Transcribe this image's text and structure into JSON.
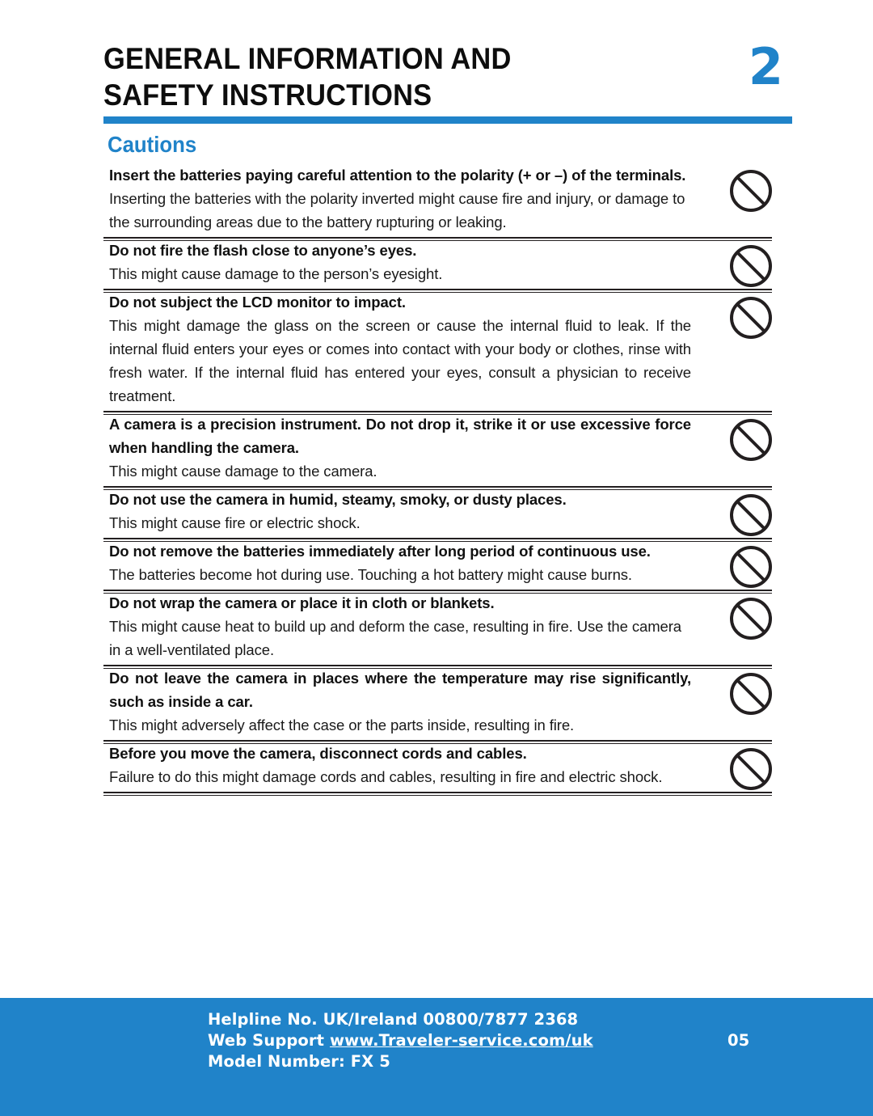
{
  "header": {
    "title": "GENERAL INFORMATION AND\nSAFETY INSTRUCTIONS",
    "chapter_number": "2",
    "accent_color": "#2083c9"
  },
  "section": {
    "heading": "Cautions"
  },
  "cautions": [
    {
      "title": "Insert the batteries paying careful attention to the polarity (+ or –) of the terminals.",
      "body": "Inserting the batteries with the polarity inverted might cause fire and injury, or damage to the surrounding areas due to the battery rupturing or leaking.",
      "icon": "prohibition-icon",
      "title_justified": true,
      "body_justified": false
    },
    {
      "title": "Do not fire the flash close to anyone’s eyes.",
      "body": "This might cause damage to the person’s eyesight.",
      "icon": "prohibition-icon",
      "title_justified": false,
      "body_justified": false
    },
    {
      "title": "Do not subject the LCD monitor to impact.",
      "body": "This might damage the glass on the screen or cause the internal fluid to leak. If the internal fluid enters your eyes or comes into contact with your body or clothes, rinse with fresh water. If the internal fluid has entered your eyes, consult a physician to receive treatment.",
      "icon": "prohibition-icon",
      "title_justified": false,
      "body_justified": true
    },
    {
      "title": "A camera is a precision instrument. Do not drop it, strike it or use excessive force when handling the camera.",
      "body": "This might cause damage to the camera.",
      "icon": "prohibition-icon",
      "title_justified": true,
      "body_justified": false
    },
    {
      "title": "Do not use the camera in humid, steamy, smoky, or dusty places.",
      "body": "This might cause fire or electric shock.",
      "icon": "prohibition-icon",
      "title_justified": false,
      "body_justified": false
    },
    {
      "title": "Do not remove the batteries immediately after long period of continuous use.",
      "body": "The batteries become hot during use. Touching a hot battery might cause burns.",
      "icon": "prohibition-icon",
      "title_justified": true,
      "body_justified": true
    },
    {
      "title": "Do not wrap the camera or place it in cloth or blankets.",
      "body": "This might cause heat to build up and deform the case, resulting in fire. Use the camera in a well-ventilated place.",
      "icon": "prohibition-icon",
      "title_justified": false,
      "body_justified": false
    },
    {
      "title": "Do not leave the camera in places where the temperature may rise significantly, such as inside a car.",
      "body": "This might adversely affect the case or the parts inside, resulting in fire.",
      "icon": "prohibition-icon",
      "title_justified": true,
      "body_justified": false
    },
    {
      "title": "Before you move the camera, disconnect cords and cables.",
      "body": "Failure to do this might damage cords and cables, resulting in fire and electric shock.",
      "icon": "prohibition-icon",
      "title_justified": false,
      "body_justified": false
    }
  ],
  "footer": {
    "helpline_label": "Helpline No. UK/Ireland 00800/7877 2368",
    "web_support_label": "Web Support ",
    "web_support_url": "www.Traveler-service.com/uk",
    "model_number": "Model Number: FX 5",
    "page_number": "05",
    "background_color": "#2083c9"
  }
}
